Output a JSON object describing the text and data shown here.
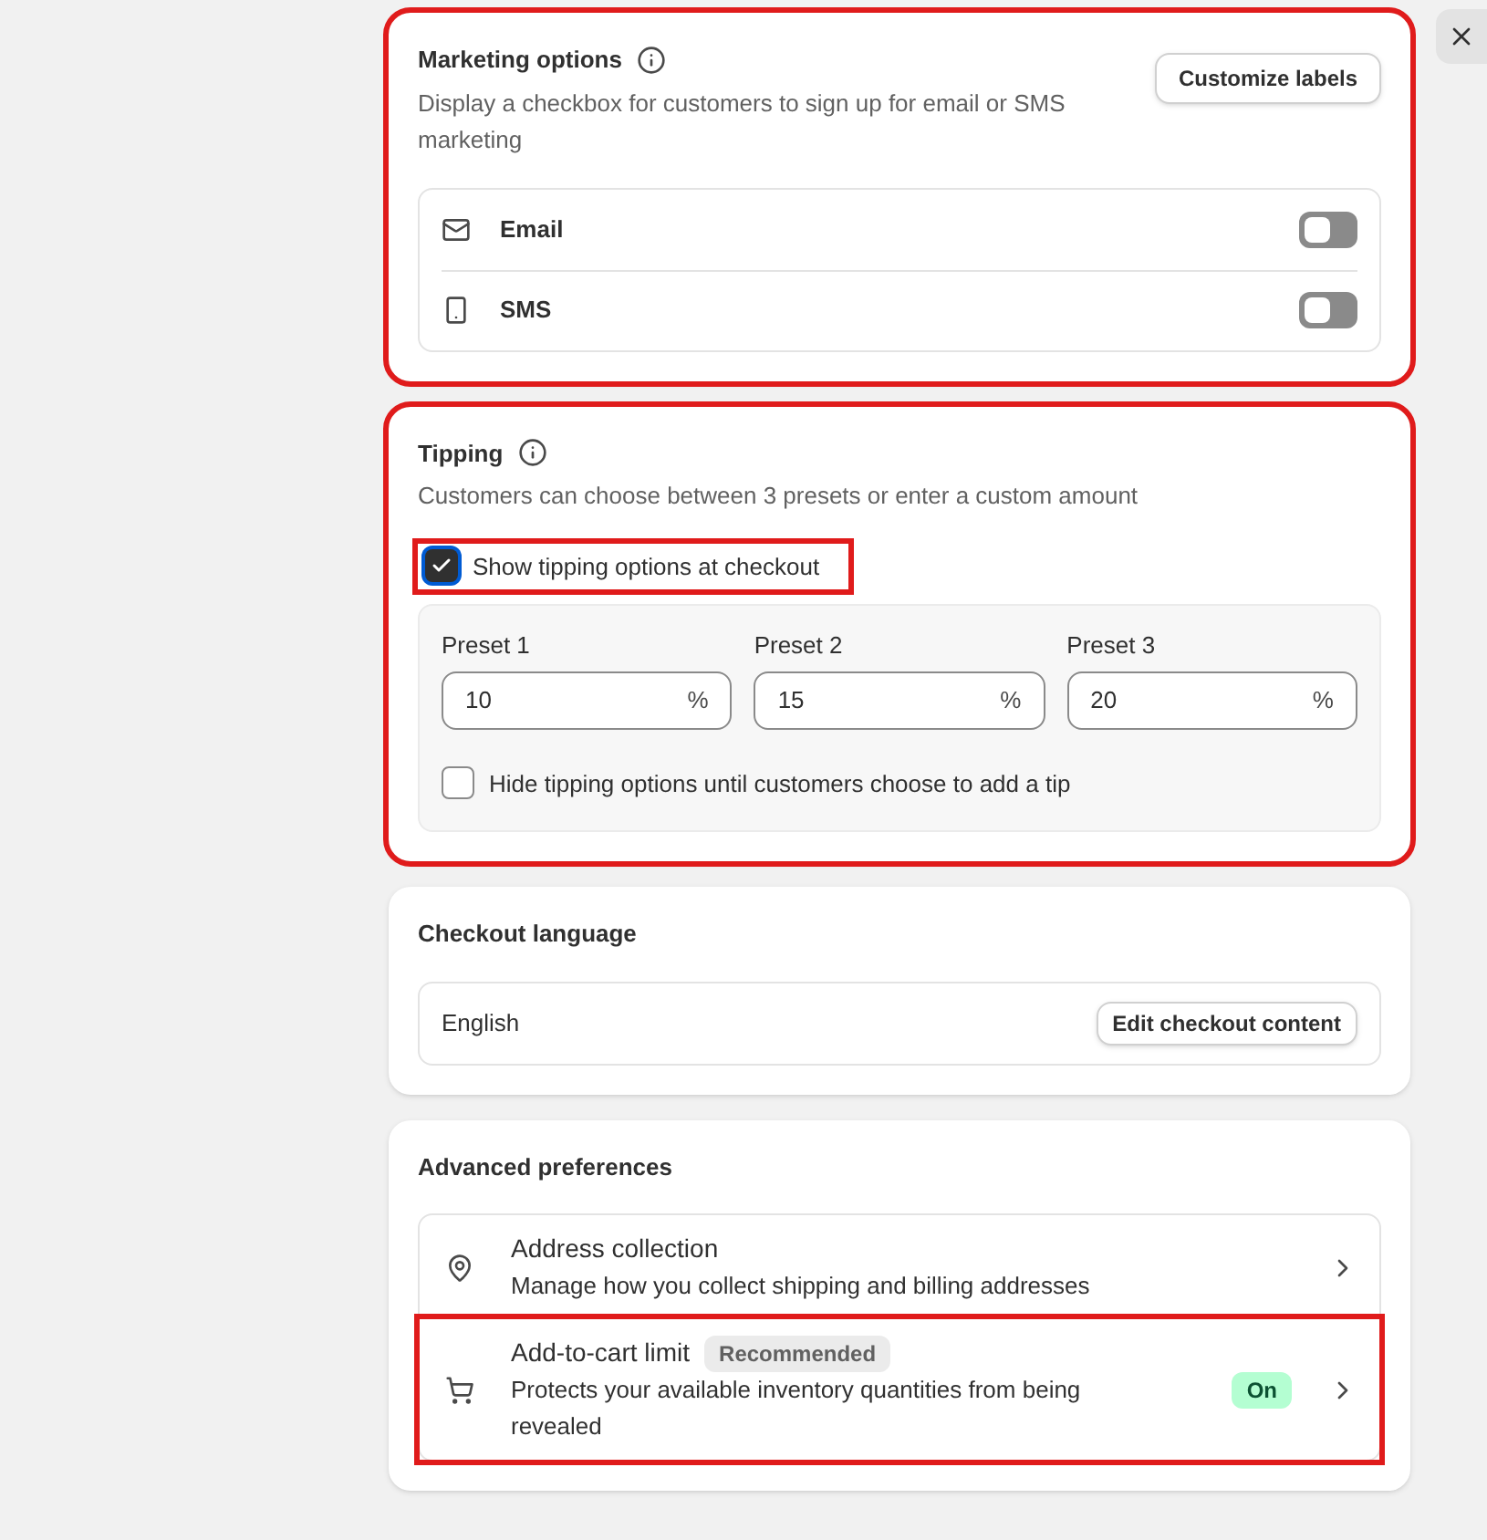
{
  "marketing": {
    "title": "Marketing options",
    "description": "Display a checkbox for customers to sign up for email or SMS marketing",
    "button": "Customize labels",
    "highlighted": true,
    "channels": [
      {
        "kind": "email",
        "label": "Email",
        "on": false
      },
      {
        "kind": "sms",
        "label": "SMS",
        "on": false
      }
    ]
  },
  "tipping": {
    "title": "Tipping",
    "description": "Customers can choose between 3 presets or enter a custom amount",
    "highlighted": true,
    "show_option": {
      "label": "Show tipping options at checkout",
      "checked": true,
      "highlighted": true
    },
    "presets": [
      {
        "label": "Preset 1",
        "value": "10",
        "unit": "%"
      },
      {
        "label": "Preset 2",
        "value": "15",
        "unit": "%"
      },
      {
        "label": "Preset 3",
        "value": "20",
        "unit": "%"
      }
    ],
    "hide_option": {
      "label": "Hide tipping options until customers choose to add a tip",
      "checked": false
    }
  },
  "checkout_language": {
    "title": "Checkout language",
    "language": "English",
    "button": "Edit checkout content"
  },
  "advanced": {
    "title": "Advanced preferences",
    "items": [
      {
        "kind": "address",
        "title": "Address collection",
        "description": "Manage how you collect shipping and billing addresses",
        "highlighted": false
      },
      {
        "kind": "cart",
        "title": "Add-to-cart limit",
        "badge": "Recommended",
        "description": "Protects your available inventory quantities from being revealed",
        "status": "On",
        "highlighted": true
      }
    ]
  }
}
